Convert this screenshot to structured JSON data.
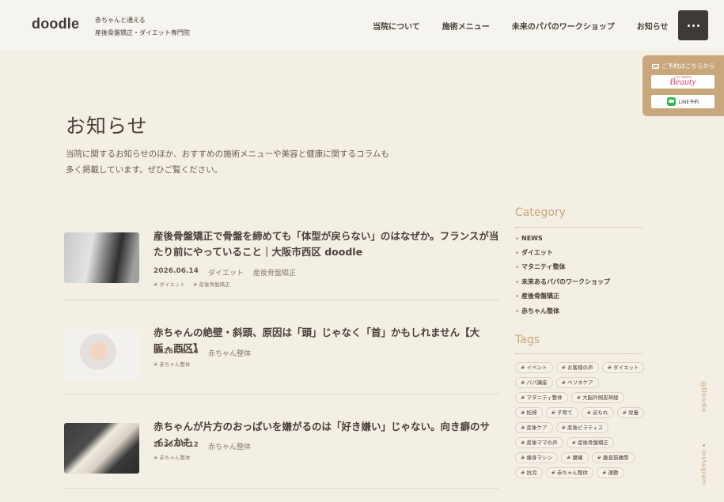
{
  "header": {
    "logo": "doodle",
    "tagline_line1": "赤ちゃんと通える",
    "tagline_line2": "産後骨盤矯正・ダイエット専門院",
    "nav": [
      "当院について",
      "施術メニュー",
      "未来のパパのワークショップ",
      "お知らせ"
    ],
    "menu_icon": "more-horizontal-icon"
  },
  "reserve": {
    "title": "ご予約はこちらから",
    "beauty_small": "HOT PEPPER",
    "beauty_label": "Beauty",
    "line_label": "LINE予約"
  },
  "page": {
    "title": "お知らせ",
    "desc_line1": "当院に関するお知らせのほか、おすすめの施術メニューや美容と健康に関するコラムも",
    "desc_line2": "多く掲載しています。ぜひご覧ください。"
  },
  "articles": [
    {
      "title": "産後骨盤矯正で骨盤を締めても「体型が戻らない」のはなぜか。フランスが当たり前にやっていること｜大阪市西区 doodle",
      "date": "2026.06.14",
      "cat1": "ダイエット",
      "cat2": "産後骨盤矯正",
      "tag1": "# ダイエット",
      "tag2": "# 産後骨盤矯正"
    },
    {
      "title": "赤ちゃんの絶壁・斜頭、原因は「頭」じゃなく「首」かもしれません【大阪・西区】",
      "date": "2026.06.14",
      "cat1": "赤ちゃん整体",
      "tag1": "# 赤ちゃん整体"
    },
    {
      "title": "赤ちゃんが片方のおっぱいを嫌がるのは「好き嫌い」じゃない。向き癖のサインかも",
      "date": "2026.06.12",
      "cat1": "赤ちゃん整体",
      "tag1": "# 赤ちゃん整体"
    }
  ],
  "sidebar": {
    "category_heading": "Category",
    "categories": [
      "NEWS",
      "ダイエット",
      "マタニティ整体",
      "未来あるパパのワークショップ",
      "産後骨盤矯正",
      "赤ちゃん整体"
    ],
    "tags_heading": "Tags",
    "tags": [
      "# イベント",
      "# お客様の声",
      "# ダイエット",
      "# パパ講座",
      "# ベリネケア",
      "# マタニティ整体",
      "# 大脳外側皮神経",
      "# 妊婦",
      "# 子育て",
      "# 戻もれ",
      "# 栄養",
      "# 産後ケア",
      "# 産後ピラティス",
      "# 産後ママの声",
      "# 産後骨盤矯正",
      "# 痩身マシン",
      "# 腰痛",
      "# 腹直筋離開",
      "# 抗児",
      "# 赤ちゃん整体",
      "# 運動"
    ]
  },
  "social": {
    "doodle": "@Doodle",
    "instagram": "Instagram"
  }
}
